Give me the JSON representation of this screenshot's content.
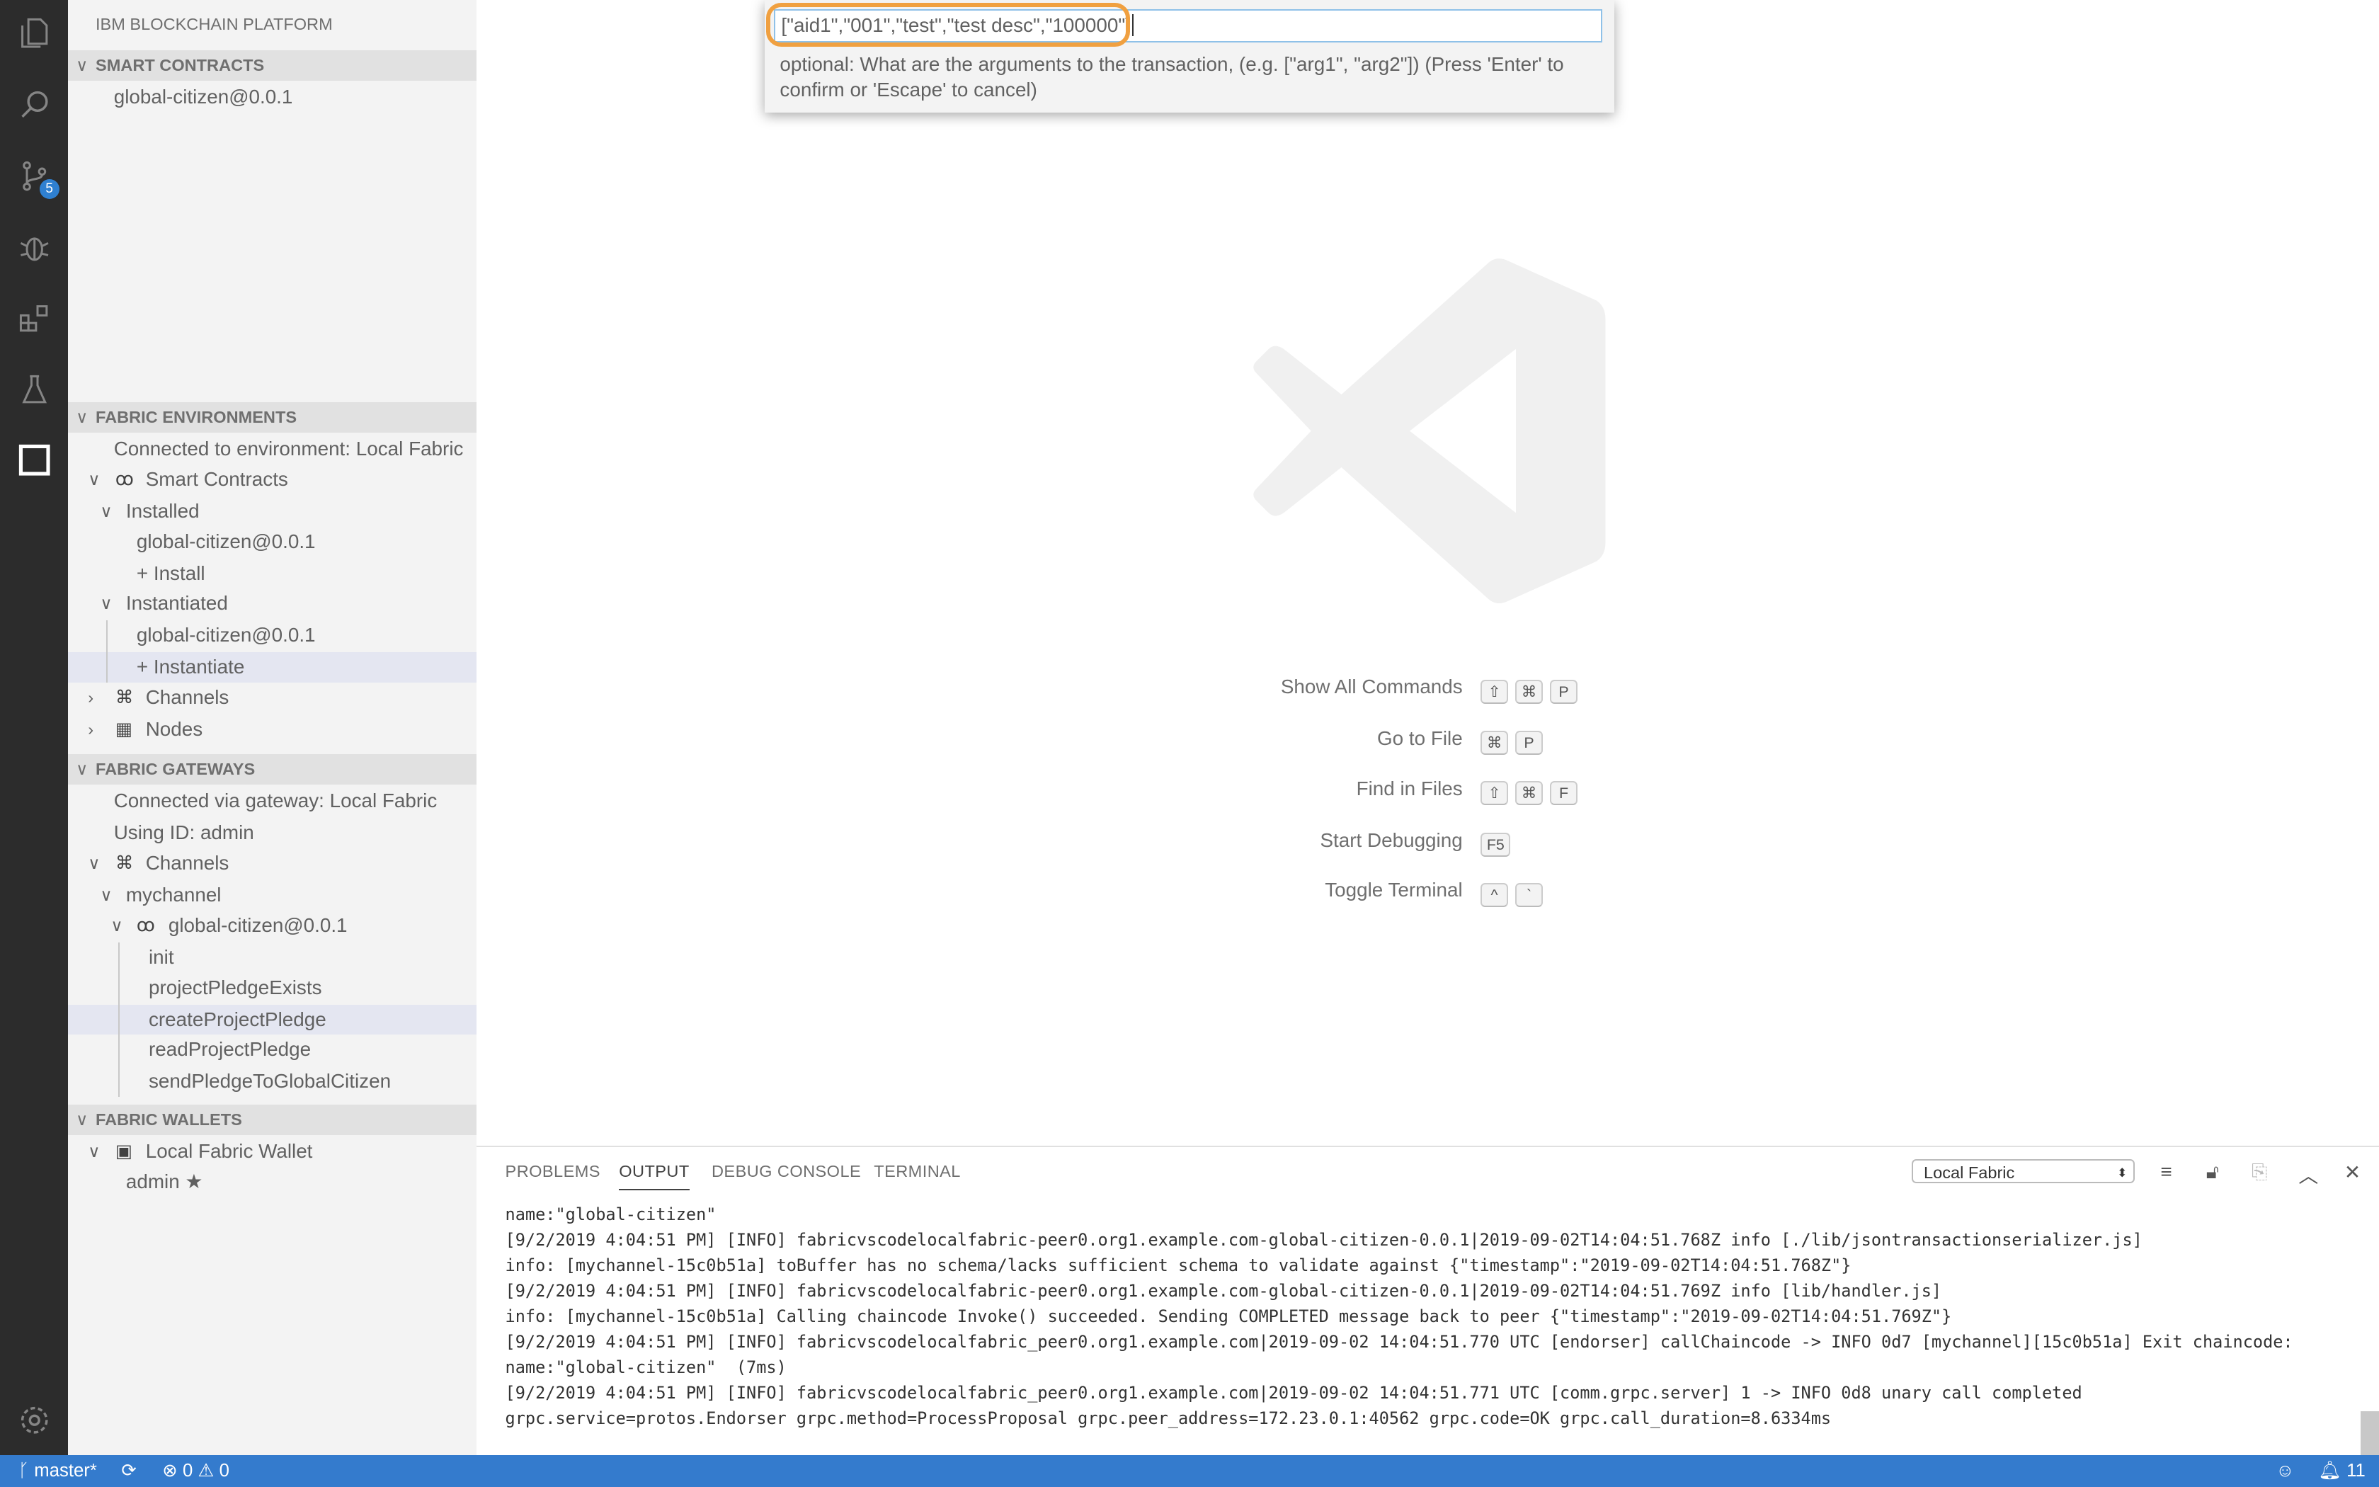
{
  "sidebar": {
    "title": "IBM BLOCKCHAIN PLATFORM",
    "smart_contracts": {
      "header": "SMART CONTRACTS",
      "items": [
        "global-citizen@0.0.1"
      ]
    },
    "fabric_environments": {
      "header": "FABRIC ENVIRONMENTS",
      "connected": "Connected to environment: Local Fabric",
      "smart_contracts": "Smart Contracts",
      "installed": "Installed",
      "installed_item": "global-citizen@0.0.1",
      "install": "+ Install",
      "instantiated": "Instantiated",
      "instantiated_item": "global-citizen@0.0.1",
      "instantiate": "+ Instantiate",
      "channels": "Channels",
      "nodes": "Nodes"
    },
    "fabric_gateways": {
      "header": "FABRIC GATEWAYS",
      "connected": "Connected via gateway: Local Fabric",
      "using_id": "Using ID: admin",
      "channels": "Channels",
      "channel": "mychannel",
      "contract": "global-citizen@0.0.1",
      "transactions": [
        "init",
        "projectPledgeExists",
        "createProjectPledge",
        "readProjectPledge",
        "sendPledgeToGlobalCitizen"
      ]
    },
    "fabric_wallets": {
      "header": "FABRIC WALLETS",
      "wallet": "Local Fabric Wallet",
      "identity": "admin ★"
    }
  },
  "activity_bar": {
    "source_control_badge": "5"
  },
  "quick_input": {
    "value": "[\"aid1\",\"001\",\"test\",\"test desc\",\"100000\"]",
    "message": "optional: What are the arguments to the transaction, (e.g. [\"arg1\", \"arg2\"]) (Press 'Enter' to confirm or 'Escape' to cancel)"
  },
  "shortcuts": [
    {
      "label": "Show All Commands",
      "keys": [
        "⇧",
        "⌘",
        "P"
      ]
    },
    {
      "label": "Go to File",
      "keys": [
        "⌘",
        "P"
      ]
    },
    {
      "label": "Find in Files",
      "keys": [
        "⇧",
        "⌘",
        "F"
      ]
    },
    {
      "label": "Start Debugging",
      "keys": [
        "F5"
      ]
    },
    {
      "label": "Toggle Terminal",
      "keys": [
        "^",
        "`"
      ]
    }
  ],
  "panel": {
    "tabs": [
      "PROBLEMS",
      "OUTPUT",
      "DEBUG CONSOLE",
      "TERMINAL"
    ],
    "active_tab": "OUTPUT",
    "output_channel": "Local Fabric",
    "output_lines": [
      "name:\"global-citizen\"",
      "[9/2/2019 4:04:51 PM] [INFO] fabricvscodelocalfabric-peer0.org1.example.com-global-citizen-0.0.1|2019-09-02T14:04:51.768Z info [./lib/jsontransactionserializer.js]",
      "info: [mychannel-15c0b51a] toBuffer has no schema/lacks sufficient schema to validate against {\"timestamp\":\"2019-09-02T14:04:51.768Z\"}",
      "[9/2/2019 4:04:51 PM] [INFO] fabricvscodelocalfabric-peer0.org1.example.com-global-citizen-0.0.1|2019-09-02T14:04:51.769Z info [lib/handler.js]",
      "info: [mychannel-15c0b51a] Calling chaincode Invoke() succeeded. Sending COMPLETED message back to peer {\"timestamp\":\"2019-09-02T14:04:51.769Z\"}",
      "[9/2/2019 4:04:51 PM] [INFO] fabricvscodelocalfabric_peer0.org1.example.com|2019-09-02 14:04:51.770 UTC [endorser] callChaincode -> INFO 0d7 [mychannel][15c0b51a] Exit chaincode:",
      "name:\"global-citizen\"  (7ms)",
      "[9/2/2019 4:04:51 PM] [INFO] fabricvscodelocalfabric_peer0.org1.example.com|2019-09-02 14:04:51.771 UTC [comm.grpc.server] 1 -> INFO 0d8 unary call completed",
      "grpc.service=protos.Endorser grpc.method=ProcessProposal grpc.peer_address=172.23.0.1:40562 grpc.code=OK grpc.call_duration=8.6334ms"
    ]
  },
  "status_bar": {
    "branch": "master*",
    "errors": "0",
    "warnings": "0",
    "notifications": "11"
  },
  "colors": {
    "status_bar": "#347bcd",
    "activity_bar": "#2c2c2c",
    "highlight": "#f0a040",
    "badge": "#2f80d1"
  }
}
